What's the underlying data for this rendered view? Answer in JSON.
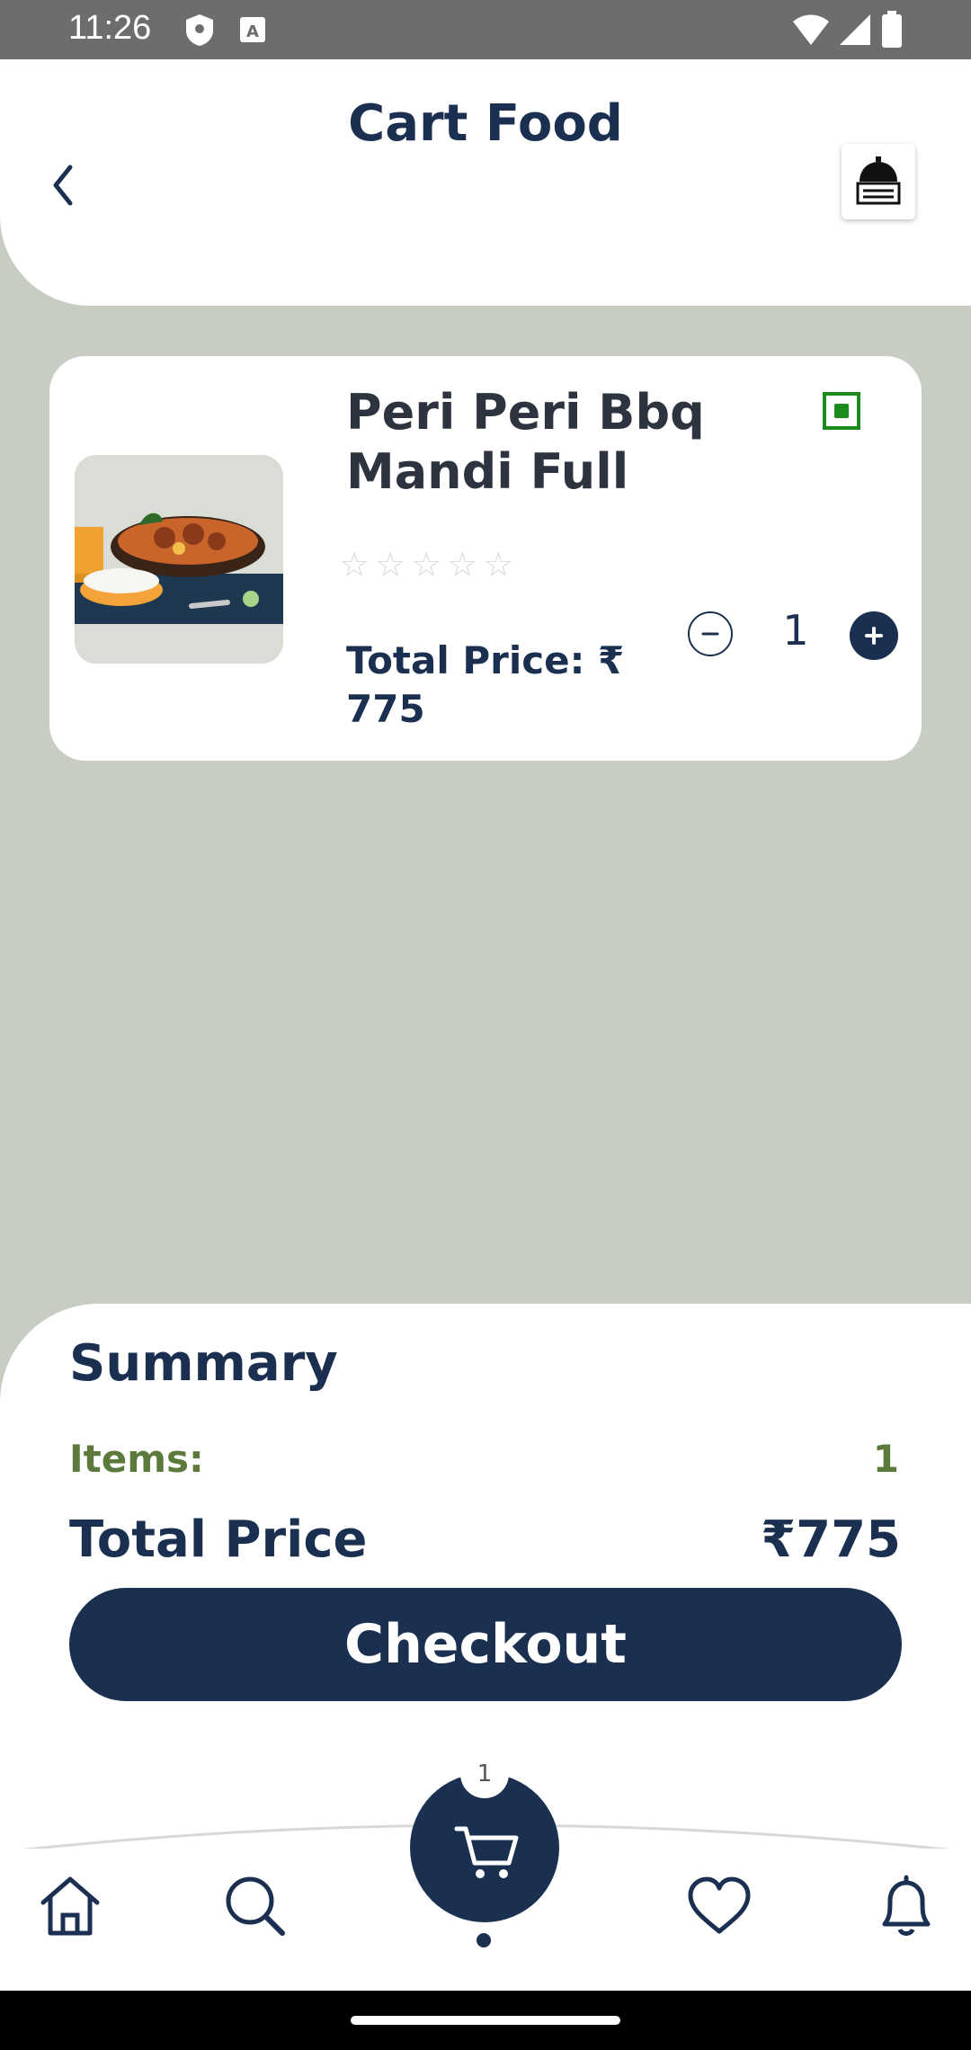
{
  "status_bar": {
    "time": "11:26"
  },
  "header": {
    "title": "Cart Food"
  },
  "cart": {
    "items": [
      {
        "name": "Peri Peri Bbq Mandi Full",
        "rating_stars": "☆☆☆☆☆",
        "total_price_label": "Total Price:  ₹ 775",
        "quantity": "1"
      }
    ]
  },
  "summary": {
    "title": "Summary",
    "items_label": "Items:",
    "items_value": "1",
    "total_label": "Total Price",
    "total_value": "₹775",
    "checkout_label": "Checkout"
  },
  "bottom_nav": {
    "cart_badge": "1"
  },
  "colors": {
    "primary": "#1b3050",
    "background": "#c8cdc4",
    "accent_green": "#5b7a3c",
    "veg_green": "#1c8a1c"
  }
}
